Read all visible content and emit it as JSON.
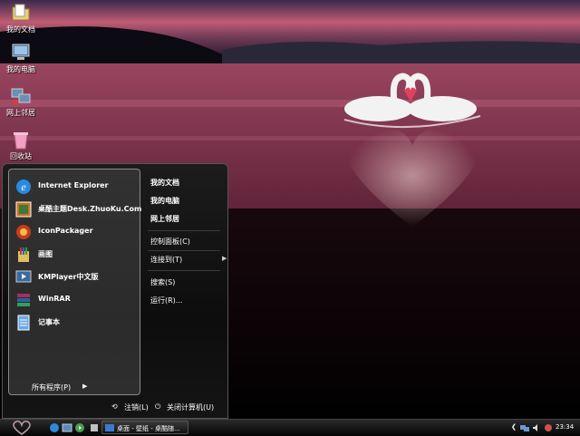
{
  "desktop": {
    "icons": [
      {
        "label": "我的文档",
        "icon": "folder-icon"
      },
      {
        "label": "我的电脑",
        "icon": "computer-icon"
      },
      {
        "label": "网上邻居",
        "icon": "network-icon"
      },
      {
        "label": "回收站",
        "icon": "recycle-bin-icon"
      }
    ]
  },
  "start_menu": {
    "programs": [
      {
        "label": "Internet Explorer",
        "icon": "internet-explorer-icon"
      },
      {
        "label": "桌酷主题Desk.ZhuoKu.Com",
        "icon": "zhuoku-icon"
      },
      {
        "label": "IconPackager",
        "icon": "iconpackager-icon"
      },
      {
        "label": "画图",
        "icon": "paint-icon"
      },
      {
        "label": "KMPlayer中文版",
        "icon": "kmplayer-icon"
      },
      {
        "label": "WinRAR",
        "icon": "winrar-icon"
      },
      {
        "label": "记事本",
        "icon": "notepad-icon"
      }
    ],
    "all_programs": "所有程序(P)",
    "right_links": {
      "my_documents": "我的文档",
      "my_computer": "我的电脑",
      "network_places": "网上邻居",
      "control_panel": "控制面板(C)",
      "connect_to": "连接到(T)",
      "search": "搜索(S)",
      "run": "运行(R)..."
    },
    "logoff": "注销(L)",
    "shutdown": "关闭计算机(U)"
  },
  "taskbar": {
    "task_label": "桌面 - 壁纸 - 桌酷随...",
    "clock": "23:34"
  }
}
